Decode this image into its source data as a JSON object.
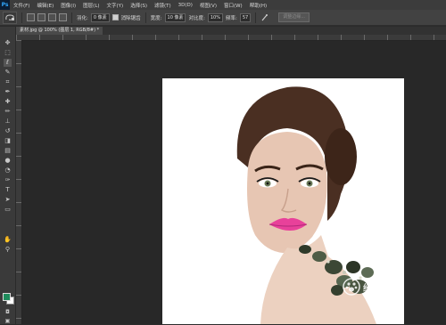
{
  "menubar": {
    "logo": "Ps",
    "items": [
      "文件(F)",
      "编辑(E)",
      "图像(I)",
      "图层(L)",
      "文字(Y)",
      "选择(S)",
      "滤镜(T)",
      "3D(D)",
      "视图(V)",
      "窗口(W)",
      "帮助(H)"
    ]
  },
  "options": {
    "feather_label": "羽化:",
    "feather_value": "0 像素",
    "antialias_label": "消除锯齿",
    "width_label": "宽度:",
    "width_value": "10 像素",
    "contrast_label": "对比度:",
    "contrast_value": "10%",
    "frequency_label": "频率:",
    "frequency_value": "57",
    "refine_edge": "调整边缘..."
  },
  "document": {
    "tab_title": "素材.jpg @ 100% (图层 1, RGB/8#) *"
  },
  "colors": {
    "foreground": "#1e8c5c",
    "background": "#ffffff"
  },
  "watermark": {
    "text": "经验"
  }
}
